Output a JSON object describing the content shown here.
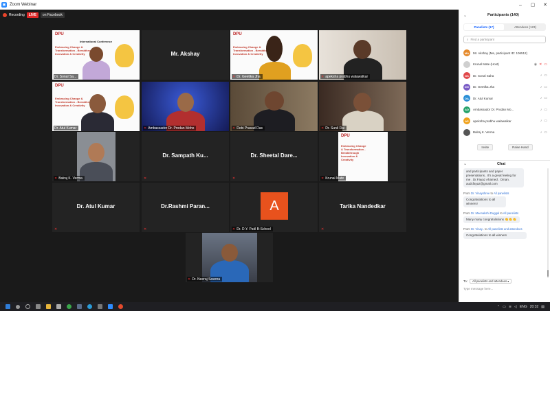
{
  "window": {
    "title": "Zoom Webinar"
  },
  "recording": {
    "label": "Recording",
    "live": "LIVE",
    "destination": "on Facebook"
  },
  "tiles": [
    {
      "id": "t1",
      "name": "Dr. Sonal Sa..."
    },
    {
      "id": "t2",
      "name": "Mr. Akshay"
    },
    {
      "id": "t3",
      "name": "Dr. Geetika Jha"
    },
    {
      "id": "t4",
      "name": "apeksha prabhu walawalkar"
    },
    {
      "id": "t5",
      "name": "Dr. Atul Kumar"
    },
    {
      "id": "t6",
      "name": "Ambassador Dr. Prodan Moho"
    },
    {
      "id": "t7",
      "name": "Debi Prasad Das"
    },
    {
      "id": "t8",
      "name": "Dr. Sunil Rai"
    },
    {
      "id": "t9",
      "name": "Balraj K. Verma"
    },
    {
      "id": "t10",
      "name": "Dr. Sampath Ku..."
    },
    {
      "id": "t11",
      "name": "Dr. Sheetal Dare..."
    },
    {
      "id": "t12",
      "name": "Krunal Mate"
    },
    {
      "id": "t13",
      "name": "Dr. Atul Kumar"
    },
    {
      "id": "t14",
      "name": "Dr.Rashmi Paran..."
    },
    {
      "id": "t15",
      "name": "Dr. D.Y. Patil B-School",
      "avatar_letter": "A"
    },
    {
      "id": "t16",
      "name": "Tarika Nandedkar"
    },
    {
      "id": "t17",
      "name": "Dr. Neeraj Saxena"
    }
  ],
  "slide": {
    "logo": "DPU",
    "conference": "International Conference",
    "theme": "Embracing Change & Transformation - Breakthrough Innovation & Creativity"
  },
  "panel": {
    "title": "Participants (140)",
    "tabs": {
      "panelists": "Panelists (17)",
      "attendees": "Attendees (123)"
    },
    "find_placeholder": "Find a participant",
    "participants": [
      {
        "initials": "MA",
        "color": "#e58a2c",
        "name": "Mr. Akshay (Me, participant ID: 106512)"
      },
      {
        "initials": "",
        "color": "#cccccc",
        "name": "Krunal Mate (Host)"
      },
      {
        "initials": "DS",
        "color": "#e0484a",
        "name": "Dr. Sonal Saha"
      },
      {
        "initials": "DG",
        "color": "#7a5cc6",
        "name": "Dr. Geetika Jha"
      },
      {
        "initials": "DA",
        "color": "#2b8fd6",
        "name": "Dr. Atul Kumar"
      },
      {
        "initials": "AD",
        "color": "#27a36b",
        "name": "Ambassador Dr. Prodan Mo..."
      },
      {
        "initials": "AP",
        "color": "#f0a21c",
        "name": "apeksha prabhu walawalkar"
      },
      {
        "initials": "",
        "color": "#555555",
        "name": "Balraj K. Verma"
      }
    ],
    "invite": "Invite",
    "raise_hand": "Raise Hand"
  },
  "chat": {
    "title": "Chat",
    "first_bubble": "and participants and paper presentations.. It's a great feeling for me . Dr.Fayaz Ahamed . Oman. audcfayaz@gmail.com",
    "messages": [
      {
        "from": "Dr. Vinayshree",
        "to": "All panelists",
        "text": "Congratulations to all winners!"
      },
      {
        "from": "Dr. Meenakshi Duggal",
        "to": "All panelists",
        "text": "Many many congratulations 👏👏👏"
      },
      {
        "from": "Dr. Vinay..",
        "to": "All panelists and attendees",
        "text": "Congratulations to all winners"
      }
    ],
    "from_prefix": "From",
    "to_word": "to",
    "to_label": "To:",
    "to_value": "All panelists and attendees ▾",
    "input_placeholder": "Type message here..."
  },
  "taskbar": {
    "lang": "ENG",
    "time": "20:32"
  }
}
